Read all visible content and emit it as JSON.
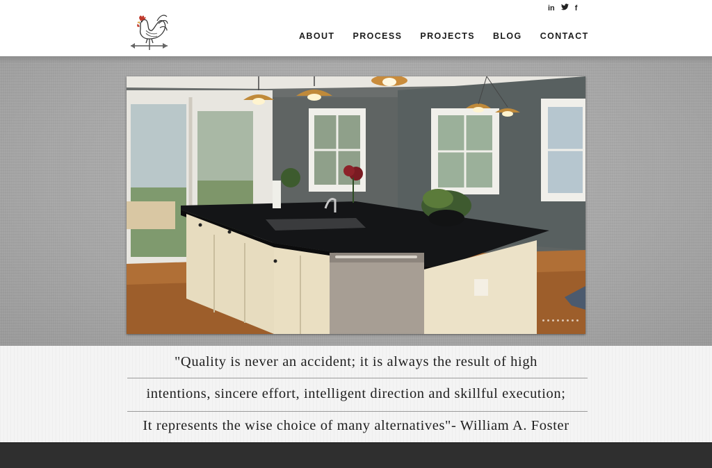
{
  "site": {
    "logo_icon": "rooster-weathervane-icon"
  },
  "social": [
    {
      "name": "linkedin-icon",
      "label": "in"
    },
    {
      "name": "twitter-icon",
      "label": "🐦"
    },
    {
      "name": "facebook-icon",
      "label": "f"
    }
  ],
  "nav": {
    "items": [
      "ABOUT",
      "PROCESS",
      "PROJECTS",
      "BLOG",
      "CONTACT"
    ]
  },
  "hero": {
    "image_icon": "kitchen-island-photo"
  },
  "quote": {
    "line1": "\"Quality is never an accident; it is always the result of high",
    "line2": "intentions, sincere effort, intelligent direction and skillful execution;",
    "line3": "It represents the wise choice of many alternatives\"- William A. Foster"
  },
  "colors": {
    "header_bg": "#ffffff",
    "band_gray": "#a9a9a9",
    "quote_bg": "#f4f4f4",
    "footer_bg": "#2f2f2f",
    "text_dark": "#1c1c1c"
  }
}
